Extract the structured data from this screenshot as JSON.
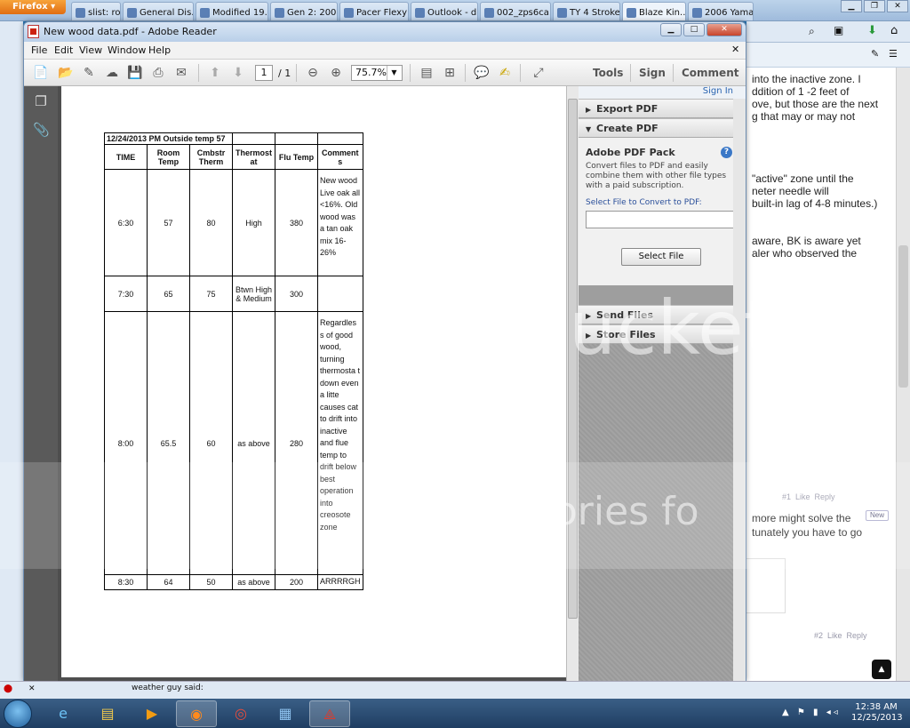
{
  "firefox": {
    "button_label": "Firefox",
    "tabs": [
      {
        "label": "slist: ro..."
      },
      {
        "label": "General Dis..."
      },
      {
        "label": "Modified 19..."
      },
      {
        "label": "Gen 2: 2000..."
      },
      {
        "label": "Pacer Flexy ..."
      },
      {
        "label": "Outlook - d..."
      },
      {
        "label": "002_zps6ca..."
      },
      {
        "label": "TY 4 Stroke ..."
      },
      {
        "label": "Blaze Kin..."
      },
      {
        "label": "2006 Yamah..."
      }
    ]
  },
  "web_page_right": {
    "lines": [
      "into the inactive zone. I",
      "ddition of 1 -2 feet of",
      "ove, but those are the next",
      "g that may or may not",
      "\"active\" zone until the",
      "neter needle will",
      "built-in lag of 4-8 minutes.)",
      "aware, BK is aware yet",
      "aler who observed the",
      "more might solve the",
      "tunately you have to go"
    ],
    "meta1": "#1  Like  Reply",
    "meta2": "#2  Like  Reply",
    "new_badge": "New"
  },
  "adobe": {
    "title": "New wood data.pdf - Adobe Reader",
    "menu": [
      "File",
      "Edit",
      "View",
      "Window",
      "Help"
    ],
    "page_current": "1",
    "page_total": "/ 1",
    "zoom": "75.7%",
    "tools_label": "Tools",
    "sign_label": "Sign",
    "comment_label": "Comment"
  },
  "pdf_table": {
    "title": "12/24/2013 PM Outside temp 57",
    "headers": [
      "TIME",
      "Room Temp",
      "Cmbstr Therm",
      "Thermost at",
      "Flu Temp",
      "Comment s"
    ],
    "rows": [
      {
        "time": "6:30",
        "room": "57",
        "cmbstr": "80",
        "thermostat": "High",
        "flu": "380",
        "comment": "New wood Live oak all <16%. Old wood was a tan oak mix 16-26%"
      },
      {
        "time": "7:30",
        "room": "65",
        "cmbstr": "75",
        "thermostat": "Btwn High & Medium",
        "flu": "300",
        "comment": ""
      },
      {
        "time": "8:00",
        "room": "65.5",
        "cmbstr": "60",
        "thermostat": "as above",
        "flu": "280",
        "comment": "Regardles s of good wood, turning thermosta t down even a litte causes cat to drift into inactive and flue temp to drift below best operation into creosote zone"
      },
      {
        "time": "8:30",
        "room": "64",
        "cmbstr": "50",
        "thermostat": "as above",
        "flu": "200",
        "comment": "ARRRRGH"
      }
    ]
  },
  "right_pane": {
    "sign_in": "Sign In",
    "export_pdf": "Export PDF",
    "create_pdf": "Create PDF",
    "pack_title": "Adobe PDF Pack",
    "pack_desc": "Convert files to PDF and easily combine them with other file types with a paid subscription.",
    "select_label": "Select File to Convert to PDF:",
    "select_button": "Select File",
    "send_files": "Send Files",
    "store_files": "Store Files"
  },
  "watermark": {
    "text1": "ucket",
    "text2": "mories fo"
  },
  "behind": {
    "bottom_text": "weather guy said:"
  },
  "taskbar": {
    "time": "12:38 AM",
    "date": "12/25/2013"
  }
}
